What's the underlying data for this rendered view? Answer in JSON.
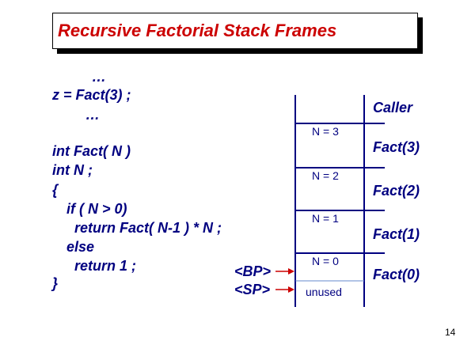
{
  "title": "Recursive Factorial Stack Frames",
  "code": [
    "…",
    "z = Fact(3) ;",
    "…",
    "int Fact( N )",
    "int N ;",
    "{",
    "if ( N > 0)",
    "return Fact( N-1 ) * N ;",
    "else",
    "return 1 ;",
    "}"
  ],
  "frames": {
    "caller": "Caller",
    "labels": [
      "Fact(3)",
      "Fact(2)",
      "Fact(1)",
      "Fact(0)"
    ],
    "cells": [
      "N = 3",
      "N = 2",
      "N = 1",
      "N = 0",
      "unused"
    ]
  },
  "pointers": {
    "bp": "<BP>",
    "sp": "<SP>"
  },
  "colors": {
    "title": "#cc0000",
    "text": "#000080",
    "arrow": "#cc0000",
    "stack_line": "#000080",
    "divider": "#6688cc"
  },
  "page_number": "14"
}
